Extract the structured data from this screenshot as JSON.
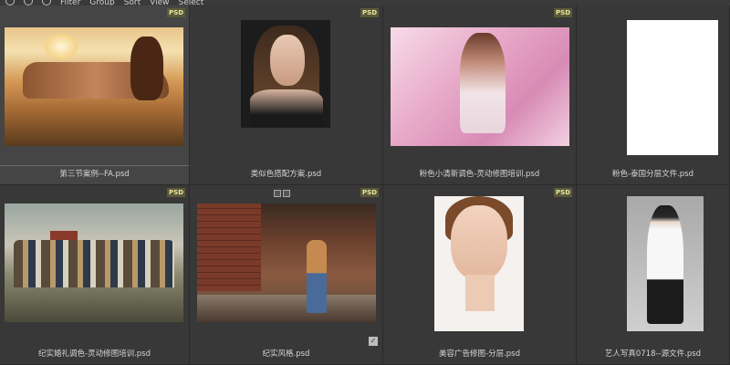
{
  "toolbar": {
    "menus": [
      "Filter",
      "Group",
      "Sort",
      "View",
      "Select"
    ]
  },
  "badge_label": "PSD",
  "items": [
    {
      "caption": "第三节案例--FA.psd",
      "thumb_icon": "beach-portrait-image",
      "has_badge": true
    },
    {
      "caption": "类似色搭配方案.psd",
      "thumb_icon": "dark-portrait-image",
      "has_badge": true
    },
    {
      "caption": "粉色小清新调色-灵动修图培训.psd",
      "thumb_icon": "pink-field-portrait-image",
      "has_badge": true
    },
    {
      "caption": "粉色-泰国分层文件.psd",
      "thumb_icon": "blank-white-image",
      "has_badge": false
    },
    {
      "caption": "纪实婚礼调色-灵动修图培训.psd",
      "thumb_icon": "wedding-group-image",
      "has_badge": true
    },
    {
      "caption": "纪实风格.psd",
      "thumb_icon": "street-kid-image",
      "has_badge": true
    },
    {
      "caption": "美容广告修图-分层.psd",
      "thumb_icon": "beauty-face-image",
      "has_badge": true
    },
    {
      "caption": "艺人写真0718--源文件.psd",
      "thumb_icon": "artist-portrait-image",
      "has_badge": false
    }
  ]
}
